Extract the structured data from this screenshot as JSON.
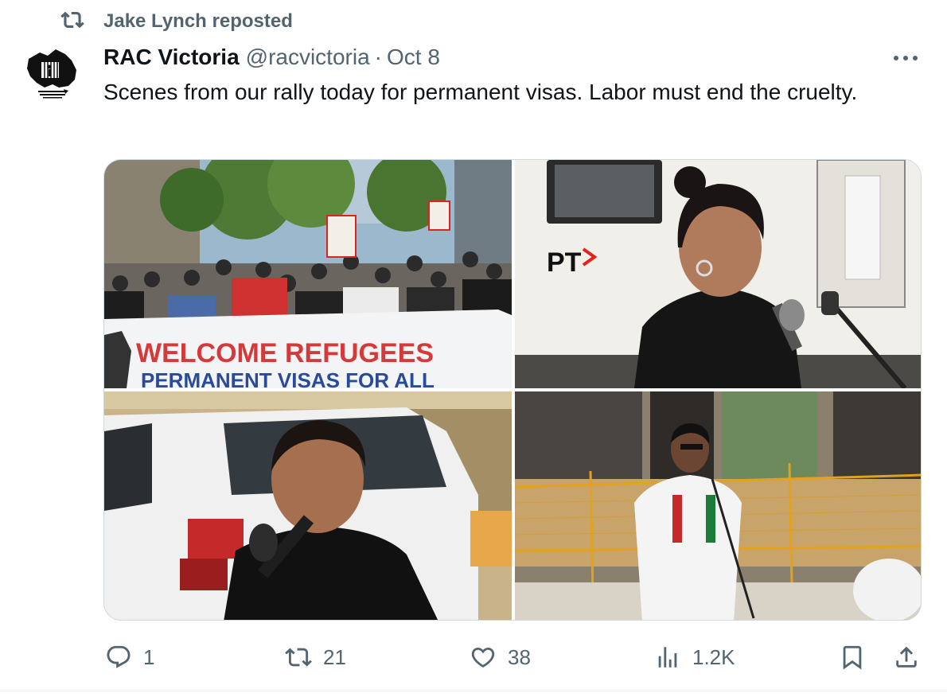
{
  "repost": {
    "label": "Jake Lynch reposted",
    "icon": "repost-icon"
  },
  "author": {
    "display_name": "RAC Victoria",
    "handle": "@racvictoria",
    "separator": "·",
    "date": "Oct 8",
    "avatar_alt": "Refugee Action Collective (Vic) logo"
  },
  "tweet": {
    "text": "Scenes from our rally today for permanent visas. Labor must end the cruelty."
  },
  "media": {
    "photo1": {
      "banner_line1": "WELCOME REFUGEES",
      "banner_line2": "PERMANENT VISAS FOR ALL"
    },
    "photo2": {
      "tram_logo": "PT"
    },
    "photo3": {},
    "photo4": {}
  },
  "actions": {
    "reply_count": "1",
    "repost_count": "21",
    "like_count": "38",
    "view_count": "1.2K"
  },
  "colors": {
    "secondary_text": "#536471",
    "primary_text": "#0f1419",
    "border": "#cfd9de"
  }
}
